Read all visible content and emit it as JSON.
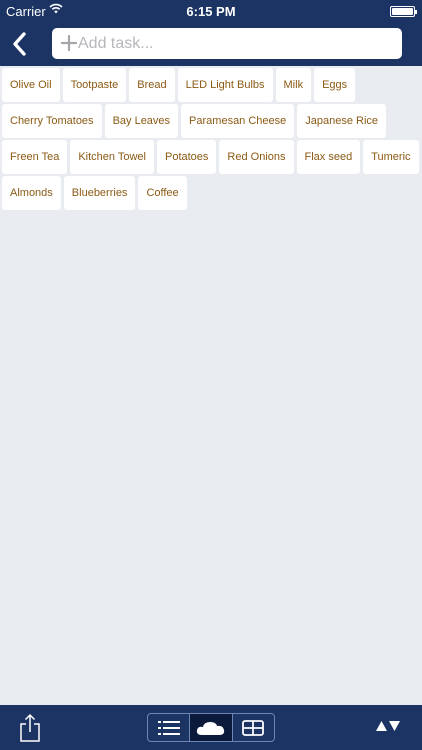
{
  "status": {
    "carrier": "Carrier",
    "time": "6:15 PM"
  },
  "nav": {
    "add_placeholder": "Add task..."
  },
  "tag_rows": [
    [
      "Olive Oil",
      "Tootpaste",
      "Bread",
      "LED Light Bulbs",
      "Milk",
      "Eggs"
    ],
    [
      "Cherry Tomatoes",
      "Bay Leaves",
      "Paramesan Cheese",
      "Japanese Rice"
    ],
    [
      "Freen Tea",
      "Kitchen Towel",
      "Potatoes",
      "Red Onions",
      "Flax seed",
      "Tumeric"
    ],
    [
      "Almonds",
      "Blueberries",
      "Coffee"
    ]
  ],
  "toolbar": {
    "view_modes": [
      "list-icon",
      "cloud-icon",
      "grid-icon"
    ],
    "active_view": "cloud-icon"
  },
  "colors": {
    "bar": "#1b3463",
    "background": "#e8ebf0",
    "tag_text": "#8b5a14"
  }
}
